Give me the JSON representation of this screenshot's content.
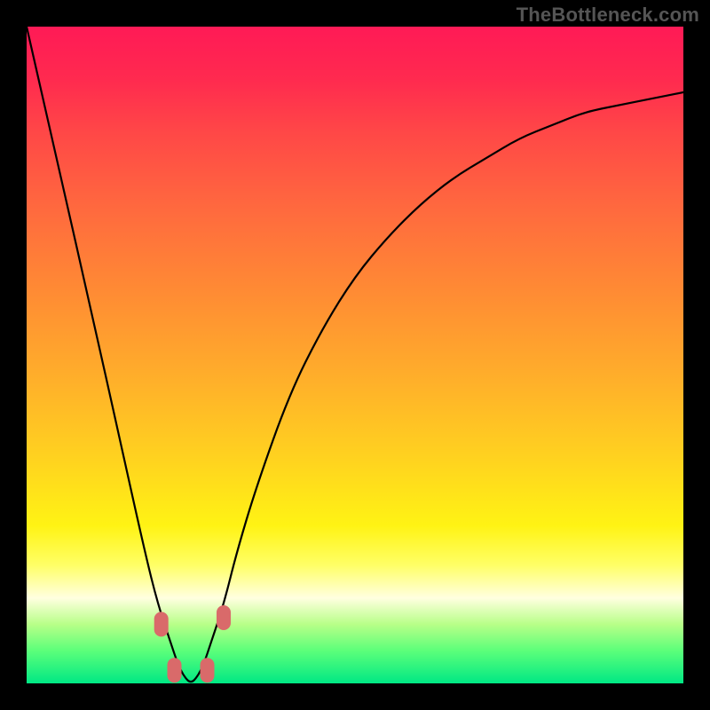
{
  "watermark": "TheBottleneck.com",
  "colors": {
    "background": "#000000",
    "curve": "#000000",
    "bead": "#d96a6a"
  },
  "chart_data": {
    "type": "line",
    "title": "",
    "xlabel": "",
    "ylabel": "",
    "xlim": [
      0,
      100
    ],
    "ylim": [
      0,
      100
    ],
    "note": "V-shaped bottleneck curve; minimum (optimal match) near x≈25. Y-axis inverted visually (0 at bottom = best, 100 at top = worst bottleneck).",
    "series": [
      {
        "name": "bottleneck-curve",
        "x": [
          0,
          5,
          10,
          14,
          18,
          20,
          22,
          23,
          24,
          25,
          26,
          27,
          28,
          30,
          32,
          35,
          40,
          45,
          50,
          55,
          60,
          65,
          70,
          75,
          80,
          85,
          90,
          95,
          100
        ],
        "values": [
          100,
          78,
          56,
          38,
          20,
          12,
          6,
          3,
          1,
          0,
          1,
          3,
          6,
          12,
          20,
          30,
          44,
          54,
          62,
          68,
          73,
          77,
          80,
          83,
          85,
          87,
          88,
          89,
          90
        ]
      }
    ],
    "markers": [
      {
        "x": 20.5,
        "y": 9
      },
      {
        "x": 22.5,
        "y": 2
      },
      {
        "x": 27.5,
        "y": 2
      },
      {
        "x": 30.0,
        "y": 10
      }
    ],
    "gradient_stops": [
      {
        "pct": 0,
        "color": "#ff1a56"
      },
      {
        "pct": 28,
        "color": "#ff6a3e"
      },
      {
        "pct": 66,
        "color": "#ffd31f"
      },
      {
        "pct": 87,
        "color": "#ffffe0"
      },
      {
        "pct": 100,
        "color": "#00e884"
      }
    ]
  }
}
